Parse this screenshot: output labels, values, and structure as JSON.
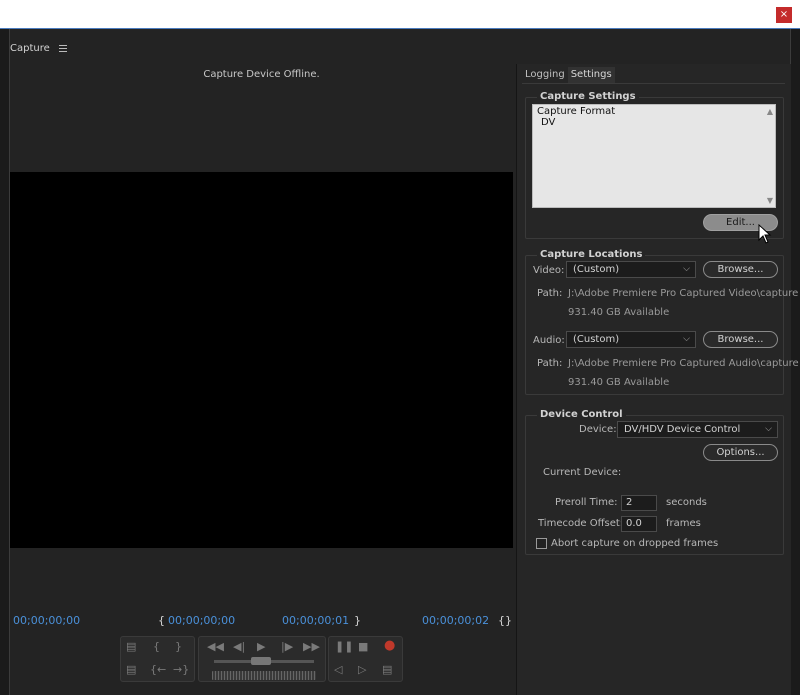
{
  "window": {
    "close_label": "×"
  },
  "panel": {
    "title": "Capture"
  },
  "monitor": {
    "status": "Capture Device Offline.",
    "timecodes": {
      "current": "00;00;00;00",
      "in": "00;00;00;00",
      "duration": "00;00;00;01",
      "out": "00;00;00;02"
    }
  },
  "tabs": [
    {
      "label": "Logging",
      "active": false
    },
    {
      "label": "Settings",
      "active": true
    }
  ],
  "capture_settings": {
    "title": "Capture Settings",
    "format_label": "Capture Format",
    "format_value": "DV",
    "edit_button": "Edit..."
  },
  "capture_locations": {
    "title": "Capture Locations",
    "video_label": "Video:",
    "video_value": "(Custom)",
    "video_browse": "Browse...",
    "video_path_label": "Path:",
    "video_path": "J:\\Adobe Premiere Pro Captured Video\\capture",
    "video_available": "931.40 GB Available",
    "audio_label": "Audio:",
    "audio_value": "(Custom)",
    "audio_browse": "Browse...",
    "audio_path_label": "Path:",
    "audio_path": "J:\\Adobe Premiere Pro Captured Audio\\capture",
    "audio_available": "931.40 GB Available"
  },
  "device_control": {
    "title": "Device Control",
    "device_label": "Device:",
    "device_value": "DV/HDV Device Control",
    "options_button": "Options...",
    "current_device_label": "Current Device:",
    "preroll_label": "Preroll Time:",
    "preroll_value": "2",
    "preroll_unit": "seconds",
    "tc_offset_label": "Timecode Offset:",
    "tc_offset_value": "0.0",
    "tc_offset_unit": "frames",
    "abort_label": "Abort capture on dropped frames",
    "abort_checked": false
  },
  "colors": {
    "timecode": "#4a90d9",
    "record": "#d23c3c",
    "close": "#c42b2b"
  }
}
